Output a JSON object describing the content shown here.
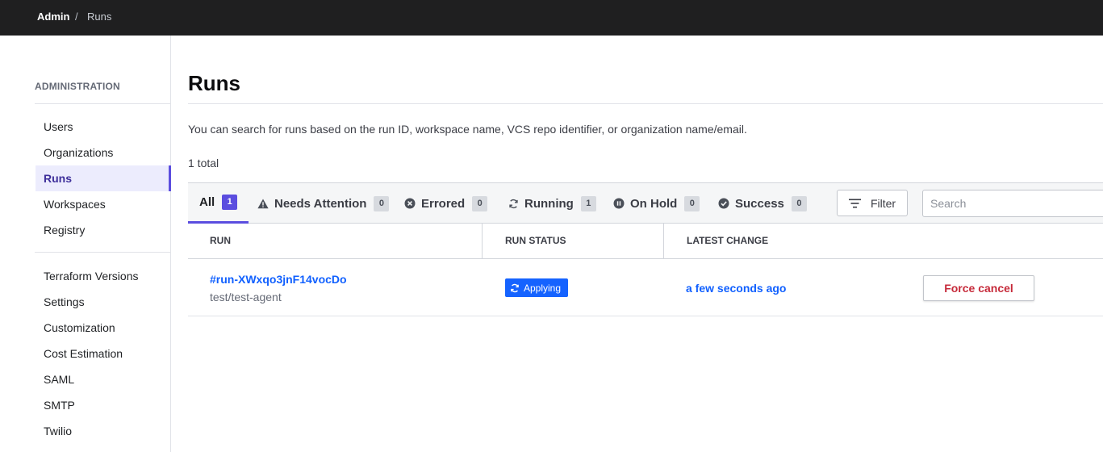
{
  "breadcrumb": {
    "root": "Admin",
    "separator": "/",
    "current": "Runs"
  },
  "sidebar": {
    "heading": "ADMINISTRATION",
    "group1": [
      {
        "label": "Users",
        "active": false
      },
      {
        "label": "Organizations",
        "active": false
      },
      {
        "label": "Runs",
        "active": true
      },
      {
        "label": "Workspaces",
        "active": false
      },
      {
        "label": "Registry",
        "active": false
      }
    ],
    "group2": [
      {
        "label": "Terraform Versions"
      },
      {
        "label": "Settings"
      },
      {
        "label": "Customization"
      },
      {
        "label": "Cost Estimation"
      },
      {
        "label": "SAML"
      },
      {
        "label": "SMTP"
      },
      {
        "label": "Twilio"
      }
    ]
  },
  "page": {
    "title": "Runs",
    "description": "You can search for runs based on the run ID, workspace name, VCS repo identifier, or organization name/email.",
    "total": "1 total"
  },
  "tabs": [
    {
      "label": "All",
      "count": "1",
      "icon": "none",
      "active": true
    },
    {
      "label": "Needs Attention",
      "count": "0",
      "icon": "warning-icon",
      "active": false
    },
    {
      "label": "Errored",
      "count": "0",
      "icon": "x-circle-icon",
      "active": false
    },
    {
      "label": "Running",
      "count": "1",
      "icon": "refresh-icon",
      "active": false
    },
    {
      "label": "On Hold",
      "count": "0",
      "icon": "pause-circle-icon",
      "active": false
    },
    {
      "label": "Success",
      "count": "0",
      "icon": "check-circle-icon",
      "active": false
    }
  ],
  "filter": {
    "label": "Filter"
  },
  "search": {
    "placeholder": "Search",
    "value": ""
  },
  "table": {
    "headers": {
      "run": "RUN",
      "status": "RUN STATUS",
      "latest": "LATEST CHANGE"
    },
    "rows": [
      {
        "run_id": "#run-XWxqo3jnF14vocDo",
        "workspace": "test/test-agent",
        "status": "Applying",
        "latest_change": "a few seconds ago",
        "action": "Force cancel"
      }
    ]
  },
  "colors": {
    "accent": "#5b4ddf",
    "link": "#1060ff",
    "status_applying": "#1563ff",
    "danger": "#c62a3a",
    "topbar": "#1f1f20"
  }
}
